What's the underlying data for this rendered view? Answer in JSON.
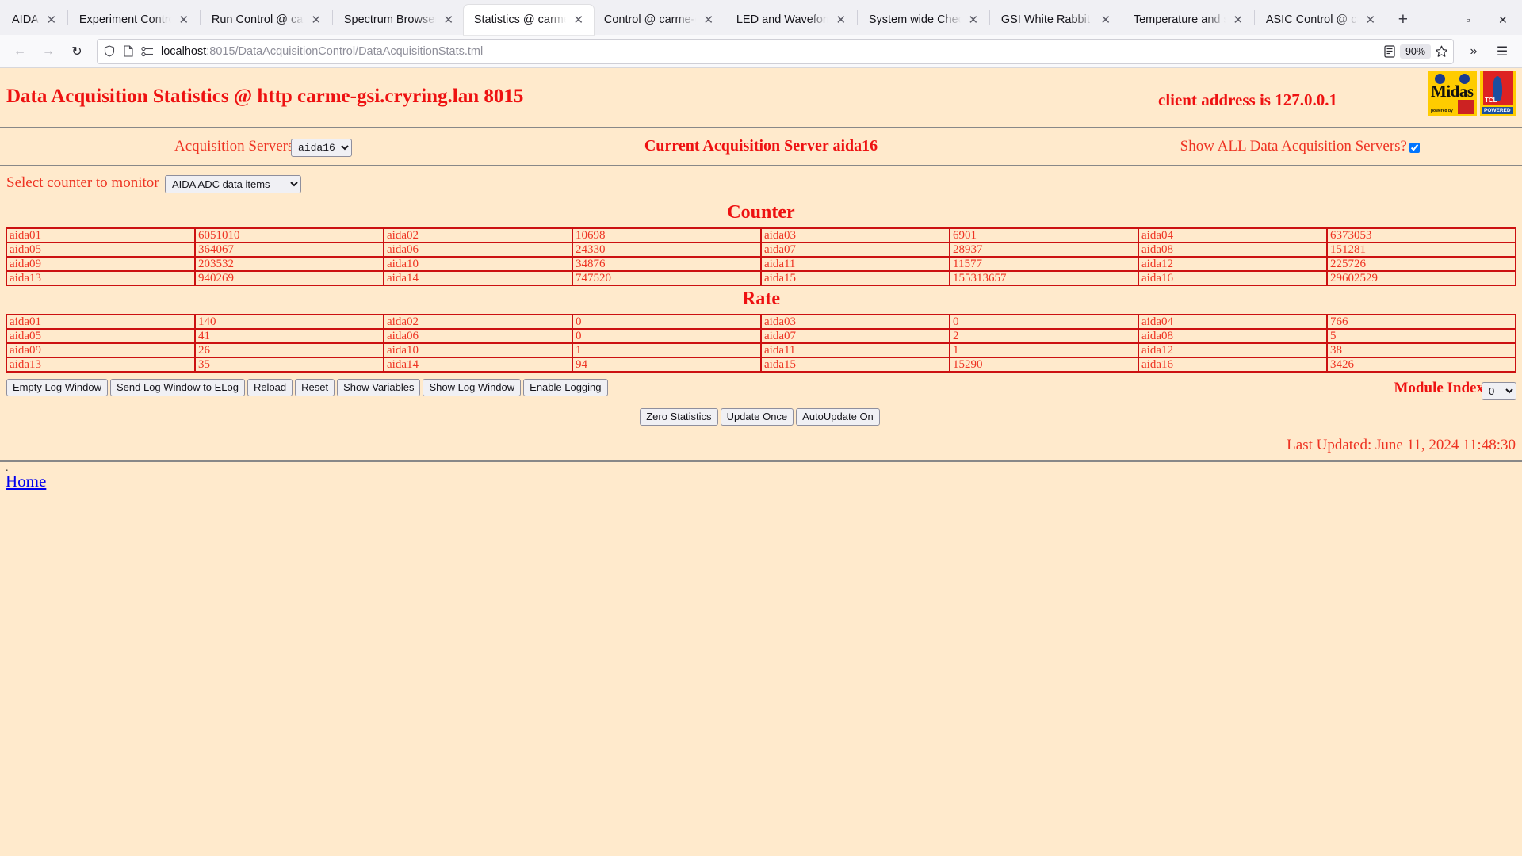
{
  "browser": {
    "tabs": [
      {
        "label": "AIDA",
        "active": false
      },
      {
        "label": "Experiment Control",
        "active": false
      },
      {
        "label": "Run Control @ carme",
        "active": false
      },
      {
        "label": "Spectrum Browser",
        "active": false
      },
      {
        "label": "Statistics @ carme-",
        "active": true
      },
      {
        "label": "Control @ carme-g",
        "active": false
      },
      {
        "label": "LED and Waveform",
        "active": false
      },
      {
        "label": "System wide Check",
        "active": false
      },
      {
        "label": "GSI White Rabbit T",
        "active": false
      },
      {
        "label": "Temperature and st",
        "active": false
      },
      {
        "label": "ASIC Control @ car",
        "active": false
      }
    ],
    "new_tab_label": "+",
    "close_glyph": "✕",
    "window_minimize": "–",
    "window_maximize": "▫",
    "window_close": "✕",
    "nav": {
      "back": "←",
      "forward": "→",
      "reload": "↻"
    },
    "url": {
      "host": "localhost",
      "path": ":8015/DataAcquisitionControl/DataAcquisitionStats.tml",
      "full": "localhost:8015/DataAcquisitionControl/DataAcquisitionStats.tml"
    },
    "zoom_level": "90%",
    "overflow_glyph": "»",
    "menu_glyph": "☰"
  },
  "header": {
    "title": "Data Acquisition Statistics @ http carme-gsi.cryring.lan 8015",
    "client_address": "client address is 127.0.0.1",
    "logo_midas": {
      "name": "Midas",
      "sub": "powered by",
      "badge": "TCL"
    },
    "logo_tcl": {
      "name": "TCL",
      "powered": "POWERED"
    }
  },
  "controls": {
    "acquisition_servers_label": "Acquisition Servers",
    "acquisition_server_value": "aida16",
    "acquisition_server_options": [
      "aida16"
    ],
    "current_server_text": "Current Acquisition Server aida16",
    "show_all_label": "Show ALL Data Acquisition Servers?",
    "show_all_checked": true,
    "counter_label": "Select counter to monitor",
    "counter_value": "AIDA ADC data items",
    "counter_options": [
      "AIDA ADC data items"
    ]
  },
  "counter_table": {
    "title": "Counter",
    "rows": [
      [
        {
          "k": "aida01",
          "v": "6051010"
        },
        {
          "k": "aida02",
          "v": "10698"
        },
        {
          "k": "aida03",
          "v": "6901"
        },
        {
          "k": "aida04",
          "v": "6373053"
        }
      ],
      [
        {
          "k": "aida05",
          "v": "364067"
        },
        {
          "k": "aida06",
          "v": "24330"
        },
        {
          "k": "aida07",
          "v": "28937"
        },
        {
          "k": "aida08",
          "v": "151281"
        }
      ],
      [
        {
          "k": "aida09",
          "v": "203532"
        },
        {
          "k": "aida10",
          "v": "34876"
        },
        {
          "k": "aida11",
          "v": "11577"
        },
        {
          "k": "aida12",
          "v": "225726"
        }
      ],
      [
        {
          "k": "aida13",
          "v": "940269"
        },
        {
          "k": "aida14",
          "v": "747520"
        },
        {
          "k": "aida15",
          "v": "155313657"
        },
        {
          "k": "aida16",
          "v": "29602529"
        }
      ]
    ]
  },
  "rate_table": {
    "title": "Rate",
    "rows": [
      [
        {
          "k": "aida01",
          "v": "140"
        },
        {
          "k": "aida02",
          "v": "0"
        },
        {
          "k": "aida03",
          "v": "0"
        },
        {
          "k": "aida04",
          "v": "766"
        }
      ],
      [
        {
          "k": "aida05",
          "v": "41"
        },
        {
          "k": "aida06",
          "v": "0"
        },
        {
          "k": "aida07",
          "v": "2"
        },
        {
          "k": "aida08",
          "v": "5"
        }
      ],
      [
        {
          "k": "aida09",
          "v": "26"
        },
        {
          "k": "aida10",
          "v": "1"
        },
        {
          "k": "aida11",
          "v": "1"
        },
        {
          "k": "aida12",
          "v": "38"
        }
      ],
      [
        {
          "k": "aida13",
          "v": "35"
        },
        {
          "k": "aida14",
          "v": "94"
        },
        {
          "k": "aida15",
          "v": "15290"
        },
        {
          "k": "aida16",
          "v": "3426"
        }
      ]
    ]
  },
  "log_buttons": [
    "Empty Log Window",
    "Send Log Window to ELog",
    "Reload",
    "Reset",
    "Show Variables",
    "Show Log Window",
    "Enable Logging"
  ],
  "module_index": {
    "label": "Module Index",
    "value": "0",
    "options": [
      "0"
    ]
  },
  "action_buttons": [
    "Zero Statistics",
    "Update Once",
    "AutoUpdate On"
  ],
  "last_updated": "Last Updated: June 11, 2024 11:48:30",
  "footer": {
    "dot": ".",
    "home_link": "Home"
  },
  "colors": {
    "page_bg": "#ffeacc",
    "accent_red": "#ee1111",
    "text_red": "#ee3322",
    "table_border": "#cc1111",
    "link_blue": "#0000ee"
  }
}
